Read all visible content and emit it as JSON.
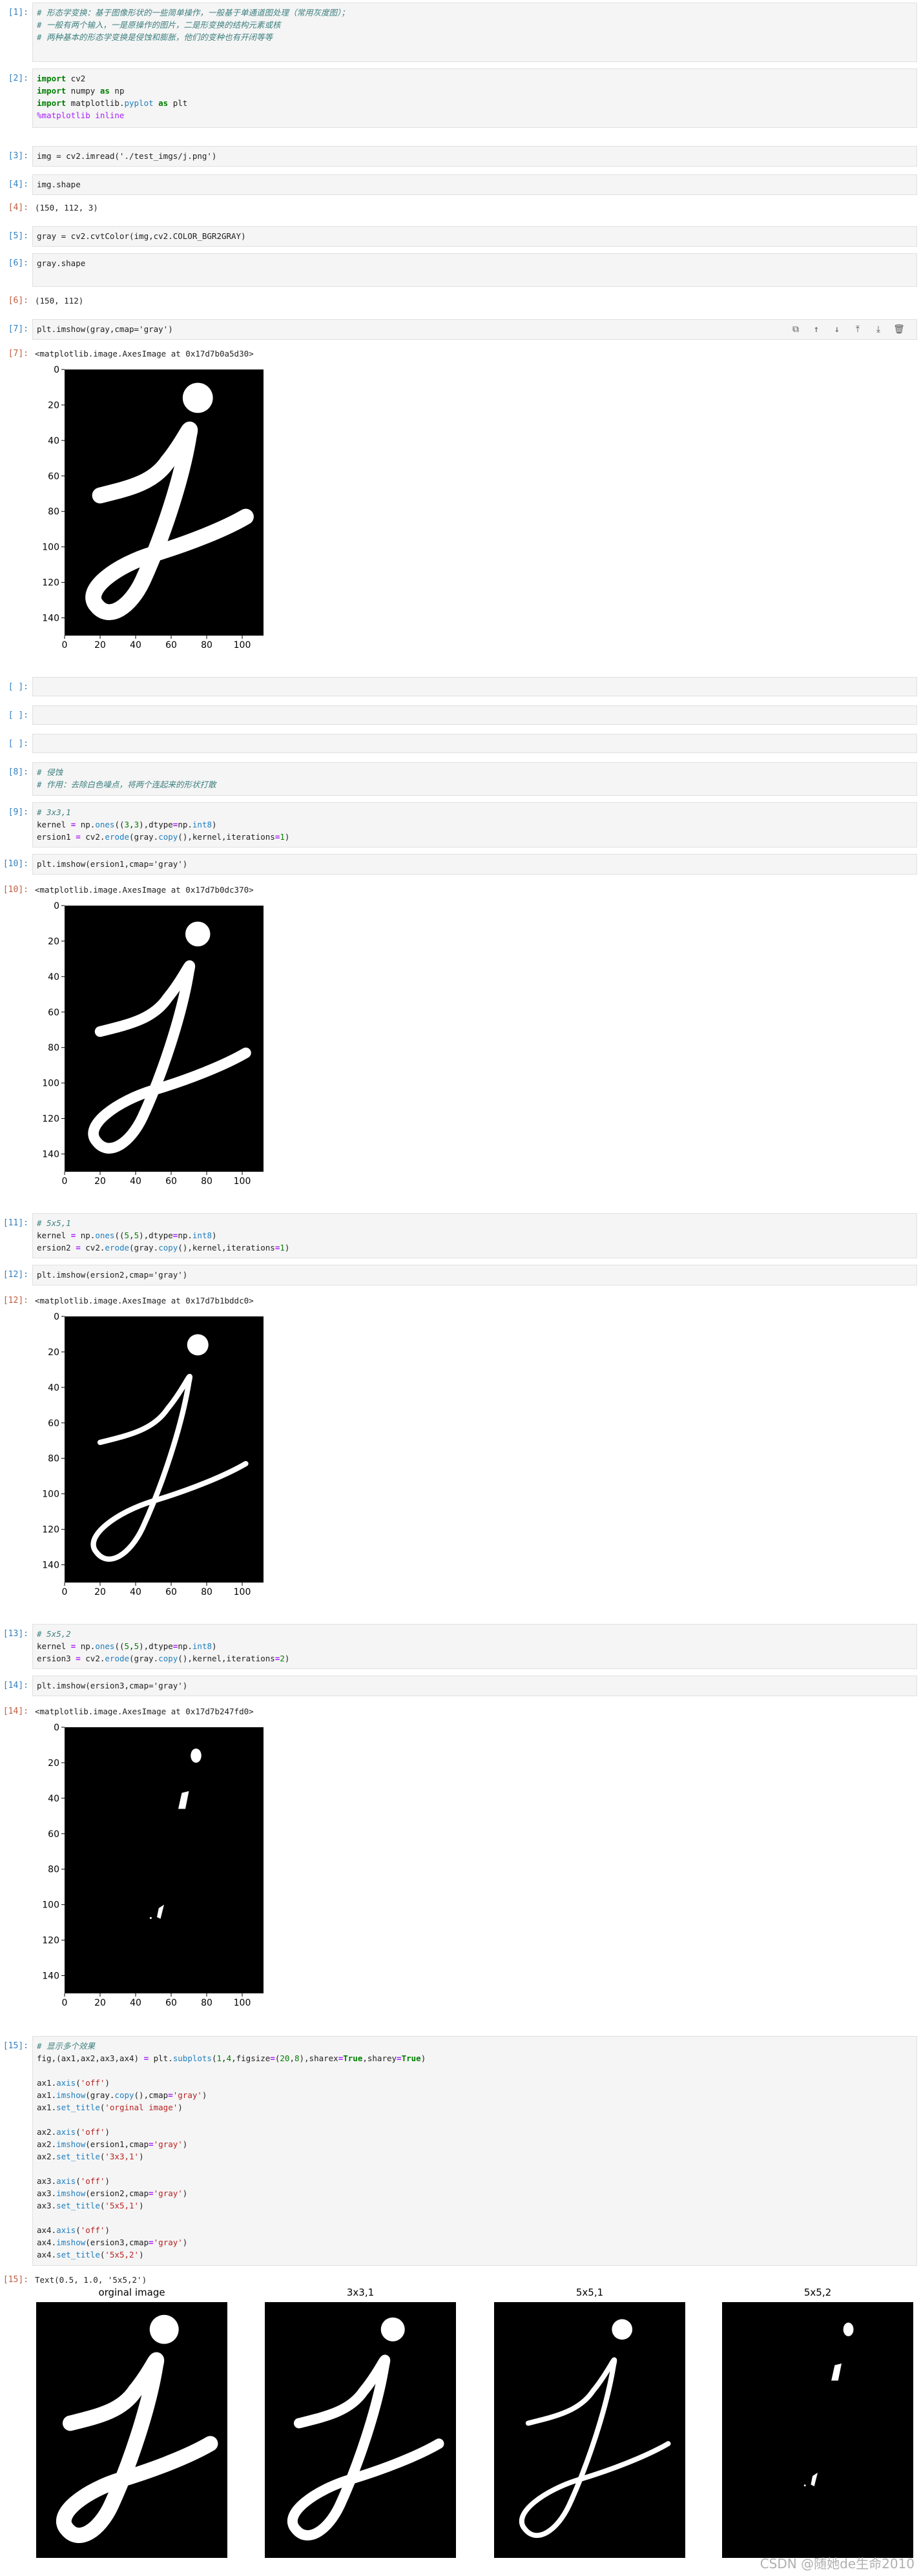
{
  "cells": {
    "c1": {
      "prompt": "[1]:",
      "lines": [
        "# 形态学变换：基于图像形状的一些简单操作，一般基于单通道图处理（常用灰度图）；",
        "# 一般有两个输入，一是原操作的图片，二是形变换的结构元素或核",
        "# 两种基本的形态学变换是侵蚀和膨胀，他们的变种也有开闭等等"
      ]
    },
    "c2": {
      "prompt": "[2]:",
      "lines": [
        "import cv2",
        "import numpy as np",
        "import matplotlib.pyplot as plt",
        "%matplotlib inline"
      ]
    },
    "c3": {
      "prompt": "[3]:",
      "lines": [
        "img = cv2.imread('./test_imgs/j.png')"
      ]
    },
    "c4": {
      "prompt": "[4]:",
      "code": "img.shape",
      "out_prompt": "[4]:",
      "output": "(150, 112, 3)"
    },
    "c5": {
      "prompt": "[5]:",
      "lines": [
        "gray = cv2.cvtColor(img,cv2.COLOR_BGR2GRAY)"
      ]
    },
    "c6": {
      "prompt": "[6]:",
      "code": "gray.shape",
      "out_prompt": "[6]:",
      "output": "(150, 112)"
    },
    "c7": {
      "prompt": "[7]:",
      "code": "plt.imshow(gray,cmap='gray')",
      "out_prompt": "[7]:",
      "output": "<matplotlib.image.AxesImage at 0x17d7b0a5d30>"
    },
    "empty": {
      "prompt": "[ ]:"
    },
    "c8": {
      "prompt": "[8]:",
      "lines": [
        "# 侵蚀",
        "# 作用：去除白色噪点，将两个连起来的形状打散"
      ]
    },
    "c9": {
      "prompt": "[9]:",
      "lines": [
        "# 3x3,1",
        "kernel = np.ones((3,3),dtype=np.int8)",
        "ersion1 = cv2.erode(gray.copy(),kernel,iterations=1)"
      ]
    },
    "c10": {
      "prompt": "[10]:",
      "code": "plt.imshow(ersion1,cmap='gray')",
      "out_prompt": "[10]:",
      "output": "<matplotlib.image.AxesImage at 0x17d7b0dc370>"
    },
    "c11": {
      "prompt": "[11]:",
      "lines": [
        "# 5x5,1",
        "kernel = np.ones((5,5),dtype=np.int8)",
        "ersion2 = cv2.erode(gray.copy(),kernel,iterations=1)"
      ]
    },
    "c12": {
      "prompt": "[12]:",
      "code": "plt.imshow(ersion2,cmap='gray')",
      "out_prompt": "[12]:",
      "output": "<matplotlib.image.AxesImage at 0x17d7b1bddc0>"
    },
    "c13": {
      "prompt": "[13]:",
      "lines": [
        "# 5x5,2",
        "kernel = np.ones((5,5),dtype=np.int8)",
        "ersion3 = cv2.erode(gray.copy(),kernel,iterations=2)"
      ]
    },
    "c14": {
      "prompt": "[14]:",
      "code": "plt.imshow(ersion3,cmap='gray')",
      "out_prompt": "[14]:",
      "output": "<matplotlib.image.AxesImage at 0x17d7b247fd0>"
    },
    "c15": {
      "prompt": "[15]:",
      "lines": [
        "# 显示多个效果",
        "fig,(ax1,ax2,ax3,ax4) = plt.subplots(1,4,figsize=(20,8),sharex=True,sharey=True)",
        "",
        "ax1.axis('off')",
        "ax1.imshow(gray.copy(),cmap='gray')",
        "ax1.set_title('orginal image')",
        "",
        "ax2.axis('off')",
        "ax2.imshow(ersion1,cmap='gray')",
        "ax2.set_title('3x3,1')",
        "",
        "ax3.axis('off')",
        "ax3.imshow(ersion2,cmap='gray')",
        "ax3.set_title('5x5,1')",
        "",
        "ax4.axis('off')",
        "ax4.imshow(ersion3,cmap='gray')",
        "ax4.set_title('5x5,2')"
      ],
      "out_prompt": "[15]:",
      "output": "Text(0.5, 1.0, '5x5,2')"
    }
  },
  "subplot_titles": [
    "orginal image",
    "3x3,1",
    "5x5,1",
    "5x5,2"
  ],
  "toolbar_icons": [
    "copy-icon",
    "move-up-icon",
    "move-down-icon",
    "insert-above-icon",
    "insert-below-icon",
    "delete-icon"
  ],
  "watermark": "CSDN @随她de生命2010",
  "chart_data": [
    {
      "type": "image",
      "title": "",
      "xlim": [
        0,
        112
      ],
      "ylim": [
        150,
        0
      ],
      "xticks": [
        0,
        20,
        40,
        60,
        80,
        100
      ],
      "yticks": [
        0,
        20,
        40,
        60,
        80,
        100,
        120,
        140
      ],
      "stroke": "thick"
    },
    {
      "type": "image",
      "title": "",
      "xlim": [
        0,
        112
      ],
      "ylim": [
        150,
        0
      ],
      "xticks": [
        0,
        20,
        40,
        60,
        80,
        100
      ],
      "yticks": [
        0,
        20,
        40,
        60,
        80,
        100,
        120,
        140
      ],
      "stroke": "medium"
    },
    {
      "type": "image",
      "title": "",
      "xlim": [
        0,
        112
      ],
      "ylim": [
        150,
        0
      ],
      "xticks": [
        0,
        20,
        40,
        60,
        80,
        100
      ],
      "yticks": [
        0,
        20,
        40,
        60,
        80,
        100,
        120,
        140
      ],
      "stroke": "thin"
    },
    {
      "type": "image",
      "title": "",
      "xlim": [
        0,
        112
      ],
      "ylim": [
        150,
        0
      ],
      "xticks": [
        0,
        20,
        40,
        60,
        80,
        100
      ],
      "yticks": [
        0,
        20,
        40,
        60,
        80,
        100,
        120,
        140
      ],
      "stroke": "fragments"
    }
  ],
  "colors": {
    "prompt_in": "#307fc1",
    "prompt_out": "#bf5b3d",
    "cell_bg": "#f5f5f5"
  }
}
